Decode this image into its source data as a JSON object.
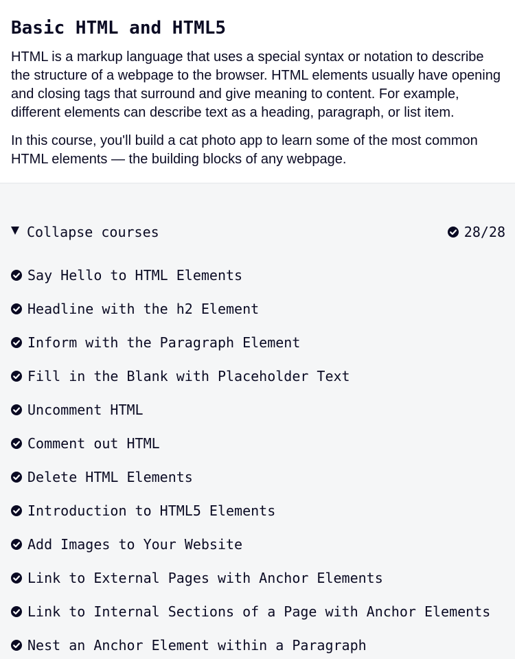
{
  "intro": {
    "title": "Basic HTML and HTML5",
    "paragraphs": [
      "HTML is a markup language that uses a special syntax or notation to describe the structure of a webpage to the browser. HTML elements usually have opening and closing tags that surround and give meaning to content. For example, different elements can describe text as a heading, paragraph, or list item.",
      "In this course, you'll build a cat photo app to learn some of the most common HTML elements — the building blocks of any webpage."
    ]
  },
  "toggle": {
    "label": "Collapse courses",
    "icon": "triangle-down-icon"
  },
  "progress": {
    "text": "28/28",
    "completed": 28,
    "total": 28,
    "icon": "check-circle-icon"
  },
  "colors": {
    "text": "#0a0a23",
    "background": "#f5f6f7",
    "intro_background": "#ffffff"
  },
  "lessons": [
    {
      "label": "Say Hello to HTML Elements",
      "completed": true
    },
    {
      "label": "Headline with the h2 Element",
      "completed": true
    },
    {
      "label": "Inform with the Paragraph Element",
      "completed": true
    },
    {
      "label": "Fill in the Blank with Placeholder Text",
      "completed": true
    },
    {
      "label": "Uncomment HTML",
      "completed": true
    },
    {
      "label": "Comment out HTML",
      "completed": true
    },
    {
      "label": "Delete HTML Elements",
      "completed": true
    },
    {
      "label": "Introduction to HTML5 Elements",
      "completed": true
    },
    {
      "label": "Add Images to Your Website",
      "completed": true
    },
    {
      "label": "Link to External Pages with Anchor Elements",
      "completed": true
    },
    {
      "label": "Link to Internal Sections of a Page with Anchor Elements",
      "completed": true
    },
    {
      "label": "Nest an Anchor Element within a Paragraph",
      "completed": true
    }
  ]
}
